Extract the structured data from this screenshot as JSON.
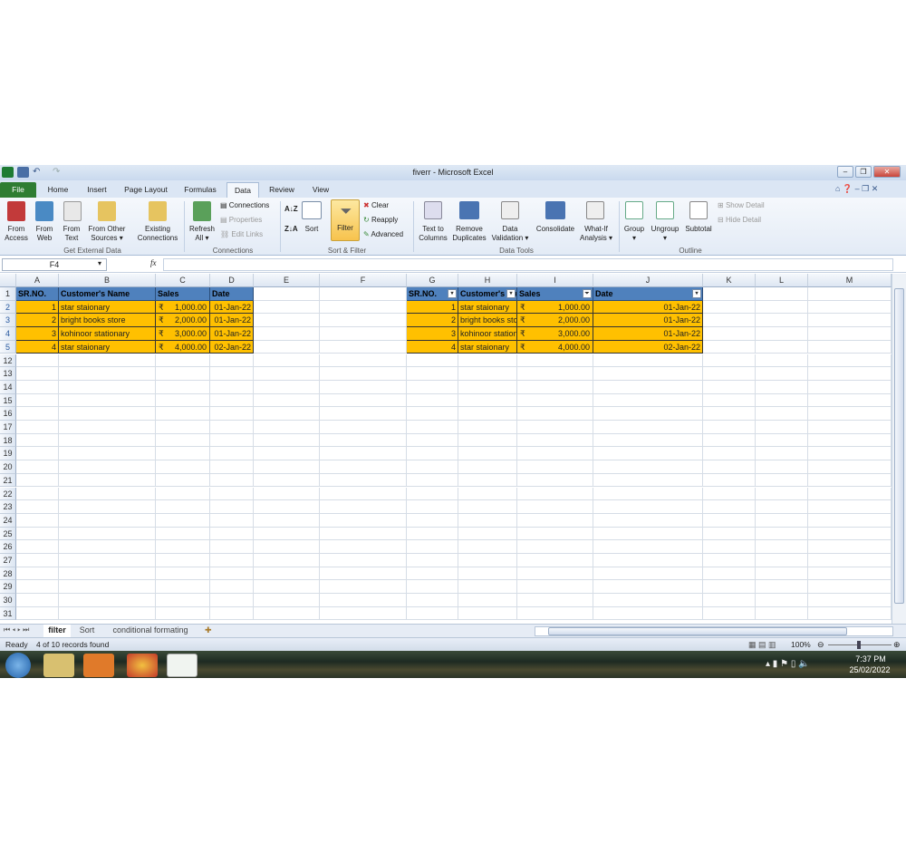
{
  "window": {
    "title": "fiverr - Microsoft Excel"
  },
  "tabs": [
    "File",
    "Home",
    "Insert",
    "Page Layout",
    "Formulas",
    "Data",
    "Review",
    "View"
  ],
  "ribbon": {
    "get_external": {
      "from_access": [
        "From",
        "Access"
      ],
      "from_web": [
        "From",
        "Web"
      ],
      "from_text": [
        "From",
        "Text"
      ],
      "from_other": [
        "From Other",
        "Sources ▾"
      ],
      "existing": [
        "Existing",
        "Connections"
      ],
      "group": "Get External Data"
    },
    "connections": {
      "refresh": [
        "Refresh",
        "All ▾"
      ],
      "connections": "Connections",
      "properties": "Properties",
      "edit_links": "Edit Links",
      "group": "Connections"
    },
    "sort_filter": {
      "sort": "Sort",
      "filter": "Filter",
      "clear": "Clear",
      "reapply": "Reapply",
      "advanced": "Advanced",
      "group": "Sort & Filter"
    },
    "data_tools": {
      "text_to_columns": [
        "Text to",
        "Columns"
      ],
      "remove_duplicates": [
        "Remove",
        "Duplicates"
      ],
      "data_validation": [
        "Data",
        "Validation ▾"
      ],
      "consolidate": "Consolidate",
      "what_if": [
        "What-If",
        "Analysis ▾"
      ],
      "group": "Data Tools"
    },
    "outline": {
      "group_btn": [
        "Group",
        "▾"
      ],
      "ungroup": [
        "Ungroup",
        "▾"
      ],
      "subtotal": "Subtotal",
      "show_detail": "Show Detail",
      "hide_detail": "Hide Detail",
      "group": "Outline"
    }
  },
  "formula_bar": {
    "name_box": "F4",
    "fx": "fx",
    "value": ""
  },
  "columns": [
    "A",
    "B",
    "C",
    "D",
    "E",
    "F",
    "G",
    "H",
    "I",
    "J",
    "K",
    "L",
    "M"
  ],
  "row_numbers": [
    "1",
    "2",
    "3",
    "4",
    "5",
    "12",
    "13",
    "14",
    "15",
    "16",
    "17",
    "18",
    "19",
    "20",
    "21",
    "22",
    "23",
    "24",
    "25",
    "26",
    "27",
    "28",
    "29",
    "30",
    "31"
  ],
  "table1": {
    "headers": [
      "SR.NO.",
      "Customer's Name",
      "Sales",
      "Date"
    ],
    "rows": [
      [
        "1",
        "star staionary",
        "₹",
        "1,000.00",
        "01-Jan-22"
      ],
      [
        "2",
        "bright books store",
        "₹",
        "2,000.00",
        "01-Jan-22"
      ],
      [
        "3",
        "kohinoor stationary",
        "₹",
        "3,000.00",
        "01-Jan-22"
      ],
      [
        "4",
        "star staionary",
        "₹",
        "4,000.00",
        "02-Jan-22"
      ]
    ]
  },
  "table2": {
    "headers": [
      "SR.NO.",
      "Customer's Name",
      "Sales",
      "Date"
    ],
    "rows": [
      [
        "1",
        "star staionary",
        "₹",
        "1,000.00",
        "01-Jan-22"
      ],
      [
        "2",
        "bright books store",
        "₹",
        "2,000.00",
        "01-Jan-22"
      ],
      [
        "3",
        "kohinoor stationary",
        "₹",
        "3,000.00",
        "01-Jan-22"
      ],
      [
        "4",
        "star staionary",
        "₹",
        "4,000.00",
        "02-Jan-22"
      ]
    ]
  },
  "sheets": [
    "filter",
    "Sort",
    "conditional formating"
  ],
  "status": {
    "ready": "Ready",
    "records": "4 of 10 records found",
    "zoom": "100%"
  },
  "taskbar": {
    "time": "7:37 PM",
    "date": "25/02/2022"
  }
}
